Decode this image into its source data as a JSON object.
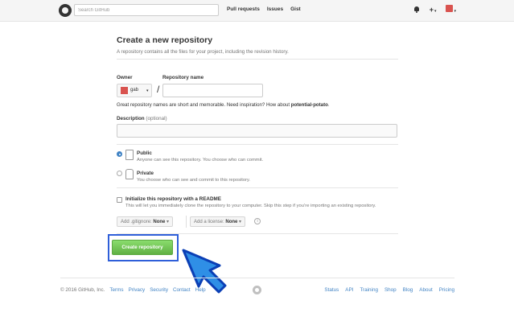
{
  "header": {
    "search_placeholder": "Search GitHub",
    "nav": [
      "Pull requests",
      "Issues",
      "Gist"
    ],
    "icons": [
      "octocat-logo-icon",
      "bell-icon",
      "plus-icon",
      "avatar-icon"
    ]
  },
  "page": {
    "title": "Create a new repository",
    "subtitle": "A repository contains all the files for your project, including the revision history."
  },
  "form": {
    "owner_label": "Owner",
    "owner_name": "gab",
    "repo_name_label": "Repository name",
    "slash": "/",
    "hint_prefix": "Great repository names are short and memorable. Need inspiration? How about ",
    "hint_suggestion": "potential-potato",
    "hint_suffix": ".",
    "description_label": "Description",
    "description_optional": "(optional)",
    "visibility": {
      "public_title": "Public",
      "public_desc": "Anyone can see this repository. You choose who can commit.",
      "private_title": "Private",
      "private_desc": "You choose who can see and commit to this repository.",
      "selected": "Public"
    },
    "init_readme_label": "Initialize this repository with a README",
    "init_readme_desc": "This will let you immediately clone the repository to your computer. Skip this step if you’re importing an existing repository.",
    "gitignore_label": "Add .gitignore:",
    "gitignore_value": "None",
    "license_label": "Add a license:",
    "license_value": "None",
    "info_icon": "i",
    "create_button": "Create repository"
  },
  "footer": {
    "copyright": "© 2016 GitHub, Inc.",
    "left_links": [
      "Terms",
      "Privacy",
      "Security",
      "Contact",
      "Help"
    ],
    "right_links": [
      "Status",
      "API",
      "Training",
      "Shop",
      "Blog",
      "About",
      "Pricing"
    ]
  },
  "colors": {
    "accent": "#4183c4",
    "create_button": "#60b044",
    "highlight_border": "#2f5fd9",
    "arrow": "#2f8fe6"
  }
}
